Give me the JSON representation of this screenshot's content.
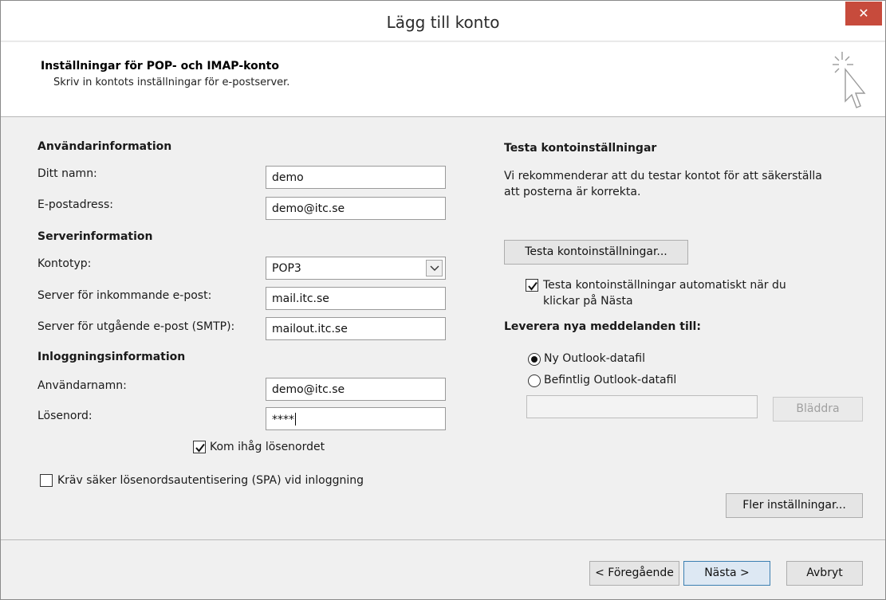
{
  "window": {
    "title": "Lägg till konto",
    "close_glyph": "✕"
  },
  "header": {
    "title": "Inställningar för POP- och IMAP-konto",
    "subtitle": "Skriv in kontots inställningar för e-postserver.",
    "icon": "cursor-sparkle-icon"
  },
  "user_info": {
    "heading": "Användarinformation",
    "name_label": "Ditt namn:",
    "name_value": "demo",
    "email_label": "E-postadress:",
    "email_value": "demo@itc.se"
  },
  "server_info": {
    "heading": "Serverinformation",
    "account_type_label": "Kontotyp:",
    "account_type_value": "POP3",
    "incoming_label": "Server för inkommande e-post:",
    "incoming_value": "mail.itc.se",
    "outgoing_label": "Server för utgående e-post (SMTP):",
    "outgoing_value": "mailout.itc.se"
  },
  "login_info": {
    "heading": "Inloggningsinformation",
    "username_label": "Användarnamn:",
    "username_value": "demo@itc.se",
    "password_label": "Lösenord:",
    "password_value": "****",
    "remember_label": "Kom ihåg lösenordet",
    "remember_checked": true,
    "spa_label": "Kräv säker lösenordsautentisering (SPA) vid inloggning",
    "spa_checked": false
  },
  "test": {
    "heading": "Testa kontoinställningar",
    "description_line1": "Vi rekommenderar att du testar kontot för att säkerställa",
    "description_line2": "att posterna är korrekta.",
    "test_button": "Testa kontoinställningar...",
    "auto_test_line1": "Testa kontoinställningar automatiskt när du",
    "auto_test_line2": "klickar på Nästa",
    "auto_test_checked": true
  },
  "deliver": {
    "heading": "Leverera nya meddelanden till:",
    "option_new": "Ny Outlook-datafil",
    "option_existing": "Befintlig Outlook-datafil",
    "selected": "new",
    "browse_button": "Bläddra"
  },
  "more_settings_button": "Fler inställningar...",
  "footer": {
    "back_button": "< Föregående",
    "next_button": "Nästa >",
    "cancel_button": "Avbryt"
  },
  "colors": {
    "close_bg": "#c74b3c",
    "primary_border": "#3c7fb1"
  }
}
